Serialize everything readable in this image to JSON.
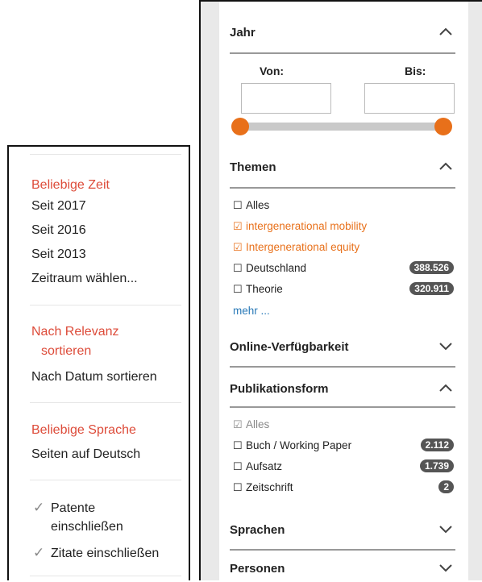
{
  "left_panel": {
    "time_filter": {
      "selected": "Beliebige Zeit",
      "options": [
        "Seit 2017",
        "Seit 2016",
        "Seit 2013",
        "Zeitraum wählen..."
      ]
    },
    "sort": {
      "selected_line1": "Nach Relevanz",
      "selected_line2": "sortieren",
      "option": "Nach Datum sortieren"
    },
    "language": {
      "selected": "Beliebige Sprache",
      "option": "Seiten auf Deutsch"
    },
    "checkboxes": {
      "patents_line1": "Patente",
      "patents_line2": "einschließen",
      "citations": "Zitate einschließen"
    },
    "check_glyph": "✓"
  },
  "right_panel": {
    "year": {
      "title": "Jahr",
      "from_label": "Von:",
      "to_label": "Bis:",
      "from_value": "",
      "to_value": "",
      "range_min_fraction": 0,
      "range_max_fraction": 1
    },
    "topics": {
      "title": "Themen",
      "items": [
        {
          "label": "Alles",
          "checked": false,
          "count": ""
        },
        {
          "label": "intergenerational mobility",
          "checked": true,
          "count": ""
        },
        {
          "label": "Intergenerational equity",
          "checked": true,
          "count": ""
        },
        {
          "label": "Deutschland",
          "checked": false,
          "count": "388.526"
        },
        {
          "label": "Theorie",
          "checked": false,
          "count": "320.911"
        }
      ],
      "more": "mehr ..."
    },
    "online": {
      "title": "Online-Verfügbarkeit"
    },
    "pubform": {
      "title": "Publikationsform",
      "items": [
        {
          "label": "Alles",
          "checked": true,
          "count": ""
        },
        {
          "label": "Buch / Working Paper",
          "checked": false,
          "count": "2.112"
        },
        {
          "label": "Aufsatz",
          "checked": false,
          "count": "1.739"
        },
        {
          "label": "Zeitschrift",
          "checked": false,
          "count": "2"
        }
      ]
    },
    "languages": {
      "title": "Sprachen"
    },
    "persons": {
      "title": "Personen"
    },
    "checked_glyph": "☑",
    "unchecked_glyph": "☐"
  },
  "colors": {
    "accent_red": "#dd4b39",
    "accent_orange": "#e8701a",
    "badge": "#555555",
    "link": "#2a7ab8"
  }
}
